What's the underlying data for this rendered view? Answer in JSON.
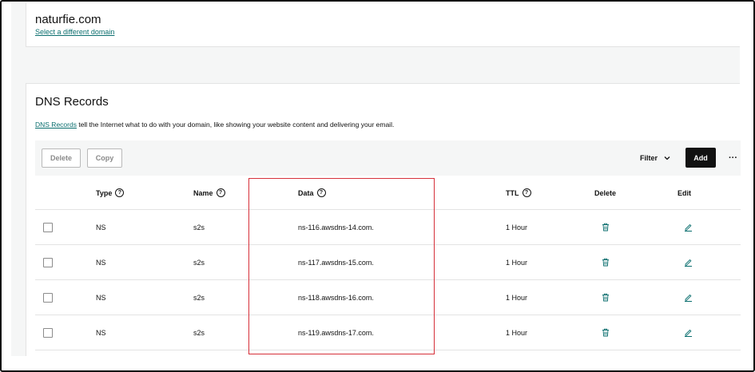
{
  "domain": {
    "name": "naturfie.com",
    "select_link": "Select a different domain"
  },
  "dns": {
    "title": "DNS Records",
    "desc_link": "DNS Records",
    "desc_rest": " tell the Internet what to do with your domain, like showing your website content and delivering your email."
  },
  "toolbar": {
    "delete_label": "Delete",
    "copy_label": "Copy",
    "filter_label": "Filter",
    "add_label": "Add",
    "more_label": "···"
  },
  "table": {
    "headers": {
      "type": "Type",
      "name": "Name",
      "data": "Data",
      "ttl": "TTL",
      "delete": "Delete",
      "edit": "Edit"
    },
    "rows": [
      {
        "type": "NS",
        "name": "s2s",
        "data": "ns-116.awsdns-14.com.",
        "ttl": "1 Hour"
      },
      {
        "type": "NS",
        "name": "s2s",
        "data": "ns-117.awsdns-15.com.",
        "ttl": "1 Hour"
      },
      {
        "type": "NS",
        "name": "s2s",
        "data": "ns-118.awsdns-16.com.",
        "ttl": "1 Hour"
      },
      {
        "type": "NS",
        "name": "s2s",
        "data": "ns-119.awsdns-17.com.",
        "ttl": "1 Hour"
      }
    ]
  },
  "colors": {
    "link": "#0a6e6e",
    "highlight": "#d6303a",
    "add_button": "#111111"
  }
}
